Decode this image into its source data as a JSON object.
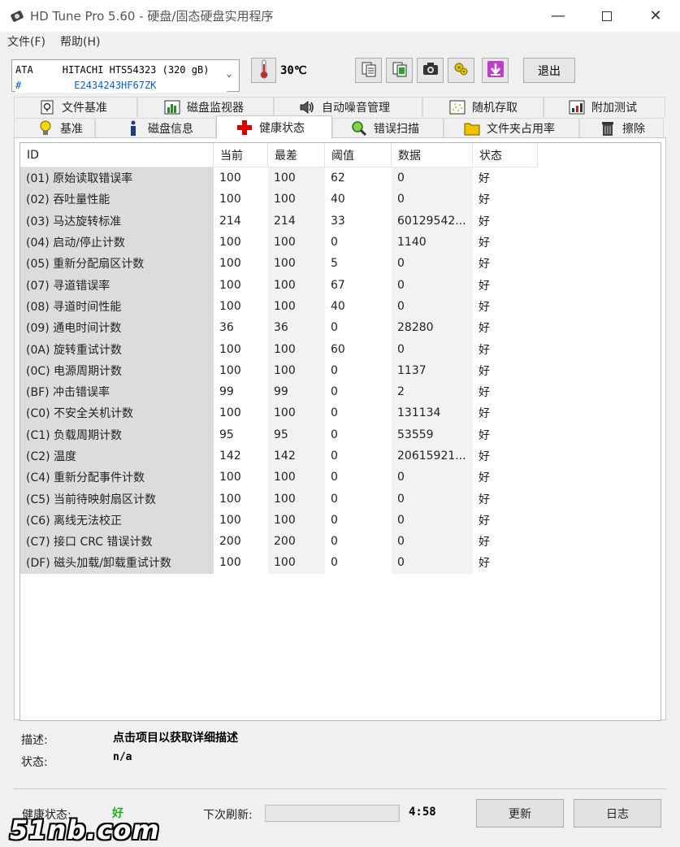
{
  "window": {
    "title": "HD Tune Pro 5.60 - 硬盘/固态硬盘实用程序"
  },
  "menu": {
    "items": [
      "文件(F)",
      "帮助(H)"
    ]
  },
  "toolbar": {
    "drive_line1": "ATA     HITACHI HTS54323 (320 gB)",
    "drive_line2": "#         E2434243HF67ZK",
    "temperature": "30℃",
    "exit_label": "退出",
    "buttons": [
      "copy-text-icon",
      "copy-info-icon",
      "screenshot-icon",
      "options-icon",
      "save-icon"
    ]
  },
  "tabs": {
    "row1": [
      "文件基准",
      "磁盘监视器",
      "自动噪音管理",
      "随机存取",
      "附加测试"
    ],
    "row2": [
      "基准",
      "磁盘信息",
      "健康状态",
      "错误扫描",
      "文件夹占用率",
      "擦除"
    ],
    "active": "健康状态"
  },
  "table": {
    "headers": [
      "ID",
      "当前",
      "最差",
      "阈值",
      "数据",
      "状态"
    ],
    "rows": [
      [
        "(01) 原始读取错误率",
        "100",
        "100",
        "62",
        "0",
        "好"
      ],
      [
        "(02) 吞吐量性能",
        "100",
        "100",
        "40",
        "0",
        "好"
      ],
      [
        "(03) 马达旋转标准",
        "214",
        "214",
        "33",
        "60129542...",
        "好"
      ],
      [
        "(04) 启动/停止计数",
        "100",
        "100",
        "0",
        "1140",
        "好"
      ],
      [
        "(05) 重新分配扇区计数",
        "100",
        "100",
        "5",
        "0",
        "好"
      ],
      [
        "(07) 寻道错误率",
        "100",
        "100",
        "67",
        "0",
        "好"
      ],
      [
        "(08) 寻道时间性能",
        "100",
        "100",
        "40",
        "0",
        "好"
      ],
      [
        "(09) 通电时间计数",
        "36",
        "36",
        "0",
        "28280",
        "好"
      ],
      [
        "(0A) 旋转重试计数",
        "100",
        "100",
        "60",
        "0",
        "好"
      ],
      [
        "(0C) 电源周期计数",
        "100",
        "100",
        "0",
        "1137",
        "好"
      ],
      [
        "(BF) 冲击错误率",
        "99",
        "99",
        "0",
        "2",
        "好"
      ],
      [
        "(C0) 不安全关机计数",
        "100",
        "100",
        "0",
        "131134",
        "好"
      ],
      [
        "(C1) 负载周期计数",
        "95",
        "95",
        "0",
        "53559",
        "好"
      ],
      [
        "(C2) 温度",
        "142",
        "142",
        "0",
        "20615921...",
        "好"
      ],
      [
        "(C4) 重新分配事件计数",
        "100",
        "100",
        "0",
        "0",
        "好"
      ],
      [
        "(C5) 当前待映射扇区计数",
        "100",
        "100",
        "0",
        "0",
        "好"
      ],
      [
        "(C6) 离线无法校正",
        "100",
        "100",
        "0",
        "0",
        "好"
      ],
      [
        "(C7) 接口 CRC 错误计数",
        "200",
        "200",
        "0",
        "0",
        "好"
      ],
      [
        "(DF) 磁头加载/卸载重试计数",
        "100",
        "100",
        "0",
        "0",
        "好"
      ]
    ]
  },
  "description": {
    "desc_label": "描述:",
    "desc_value": "点击项目以获取详细描述",
    "status_label": "状态:",
    "status_value": "n/a"
  },
  "status_bar": {
    "health_label": "健康状态:",
    "health_value": "好",
    "refresh_label": "下次刷新:",
    "refresh_progress": 0.0,
    "countdown": "4:58",
    "update_button": "更新",
    "log_button": "日志"
  },
  "watermark": "51nb.com",
  "colors": {
    "health_ok": "#1fb01f",
    "serial_text": "#0b5fcf",
    "temp_icon": "#d42020",
    "health_tab_icon": "#d40000"
  }
}
